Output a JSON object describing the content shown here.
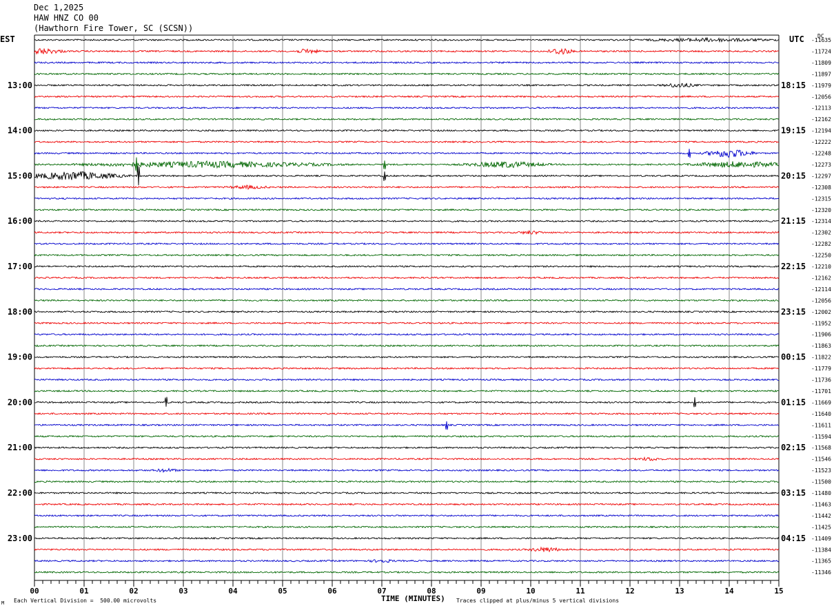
{
  "header": {
    "date": "Dec 1,2025",
    "station": "HAW HNZ CO 00",
    "location": "(Hawthorn Fire Tower, SC (SCSN))"
  },
  "labels": {
    "left_timezone": "EST",
    "right_timezone": "UTC",
    "dc_header": "DC"
  },
  "footer": {
    "xlabel": "TIME (MINUTES)",
    "vertical_division": "Each Vertical Division =  500.00 microvolts",
    "clipping": "Traces clipped at plus/minus 5 vertical divisions",
    "corner_mark": "M"
  },
  "colors": {
    "trace_cycle": [
      "#000000",
      "#ee0000",
      "#0000cc",
      "#006600"
    ],
    "grid": "#888888"
  },
  "chart_data": {
    "type": "line",
    "subtype": "helicorder",
    "title": "",
    "xlabel": "TIME (MINUTES)",
    "xlim": [
      0,
      15
    ],
    "x_ticks": [
      "00",
      "01",
      "02",
      "03",
      "04",
      "05",
      "06",
      "07",
      "08",
      "09",
      "10",
      "11",
      "12",
      "13",
      "14",
      "15"
    ],
    "trace_minutes": 15,
    "left_hour_labels": [
      "13:00",
      "14:00",
      "15:00",
      "16:00",
      "17:00",
      "18:00",
      "19:00",
      "20:00",
      "21:00",
      "22:00",
      "23:00"
    ],
    "right_hour_labels": [
      "18:15",
      "19:15",
      "20:15",
      "21:15",
      "22:15",
      "23:15",
      "00:15",
      "01:15",
      "02:15",
      "03:15",
      "04:15"
    ],
    "label_start_row": 4,
    "rows_per_hour": 4,
    "dc_offsets": [
      -11635,
      -11724,
      -11809,
      -11897,
      -11979,
      -12056,
      -12113,
      -12162,
      -12194,
      -12222,
      -12248,
      -12273,
      -12297,
      -12308,
      -12315,
      -12320,
      -12314,
      -12302,
      -12282,
      -12250,
      -12210,
      -12162,
      -12114,
      -12056,
      -12002,
      -11952,
      -11906,
      -11863,
      -11822,
      -11779,
      -11736,
      -11701,
      -11669,
      -11640,
      -11611,
      -11594,
      -11568,
      -11546,
      -11523,
      -11500,
      -11480,
      -11463,
      -11442,
      -11425,
      -11409,
      -11384,
      -11365,
      -11346
    ],
    "events": [
      {
        "row": 0,
        "minute": 13.6,
        "amp": 2,
        "width": 1.5
      },
      {
        "row": 1,
        "minute": 0.1,
        "amp": 4,
        "width": 0.6
      },
      {
        "row": 1,
        "minute": 5.5,
        "amp": 3,
        "width": 0.3
      },
      {
        "row": 1,
        "minute": 10.6,
        "amp": 5,
        "width": 0.3
      },
      {
        "row": 4,
        "minute": 13.0,
        "amp": 3,
        "width": 0.4
      },
      {
        "row": 10,
        "minute": 13.2,
        "amp": 6,
        "width": 0.2,
        "spike": true
      },
      {
        "row": 10,
        "minute": 14.0,
        "amp": 6,
        "width": 0.6
      },
      {
        "row": 11,
        "minute": 2.05,
        "amp": 9,
        "width": 0.1,
        "spike": true
      },
      {
        "row": 11,
        "minute": 3.5,
        "amp": 4,
        "width": 3
      },
      {
        "row": 11,
        "minute": 7.05,
        "amp": 6,
        "width": 0.1,
        "spike": true
      },
      {
        "row": 11,
        "minute": 9.5,
        "amp": 4,
        "width": 1
      },
      {
        "row": 11,
        "minute": 14.2,
        "amp": 4,
        "width": 1.2
      },
      {
        "row": 12,
        "minute": 0.8,
        "amp": 6,
        "width": 1.2
      },
      {
        "row": 12,
        "minute": 2.1,
        "amp": 14,
        "width": 0.05,
        "spike": true
      },
      {
        "row": 12,
        "minute": 7.05,
        "amp": 7,
        "width": 0.05,
        "spike": true
      },
      {
        "row": 13,
        "minute": 4.3,
        "amp": 2,
        "width": 0.5
      },
      {
        "row": 17,
        "minute": 10.0,
        "amp": 2,
        "width": 0.3
      },
      {
        "row": 32,
        "minute": 2.65,
        "amp": 7,
        "width": 0.05,
        "spike": true
      },
      {
        "row": 32,
        "minute": 13.3,
        "amp": 7,
        "width": 0.05,
        "spike": true
      },
      {
        "row": 34,
        "minute": 8.3,
        "amp": 6,
        "width": 0.05,
        "spike": true
      },
      {
        "row": 37,
        "minute": 12.4,
        "amp": 2,
        "width": 0.3
      },
      {
        "row": 38,
        "minute": 2.65,
        "amp": 2,
        "width": 0.3
      },
      {
        "row": 45,
        "minute": 10.3,
        "amp": 3,
        "width": 0.4
      },
      {
        "row": 46,
        "minute": 7.0,
        "amp": 2,
        "width": 0.3
      }
    ]
  }
}
